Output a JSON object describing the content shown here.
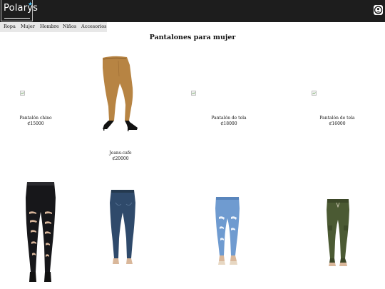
{
  "header": {
    "logo_text": "Polarys",
    "logo_icon": "star-icon",
    "user_icon": "user-icon"
  },
  "nav": {
    "items": [
      "Ropa",
      "Mujer",
      "Hombre",
      "Niños",
      "Accesorios"
    ]
  },
  "main": {
    "title": "Pantalones para mujer",
    "products": [
      {
        "name": "Pantalón chino",
        "price": "₡15000"
      },
      {
        "name": "Jeans-cafe",
        "price": "₡20000"
      },
      {
        "name": "Pantalón de tela",
        "price": "₡18000"
      },
      {
        "name": "Pantalón de tela",
        "price": "₡16000"
      }
    ]
  },
  "colors": {
    "topbar": "#1d1d1d",
    "nav_bg": "#e8e8e8",
    "tan_pants": "#b78443",
    "black_jeans": "#17171a",
    "dark_denim": "#2f4a6b",
    "light_denim": "#6f9bd0",
    "olive": "#4b5a33"
  }
}
